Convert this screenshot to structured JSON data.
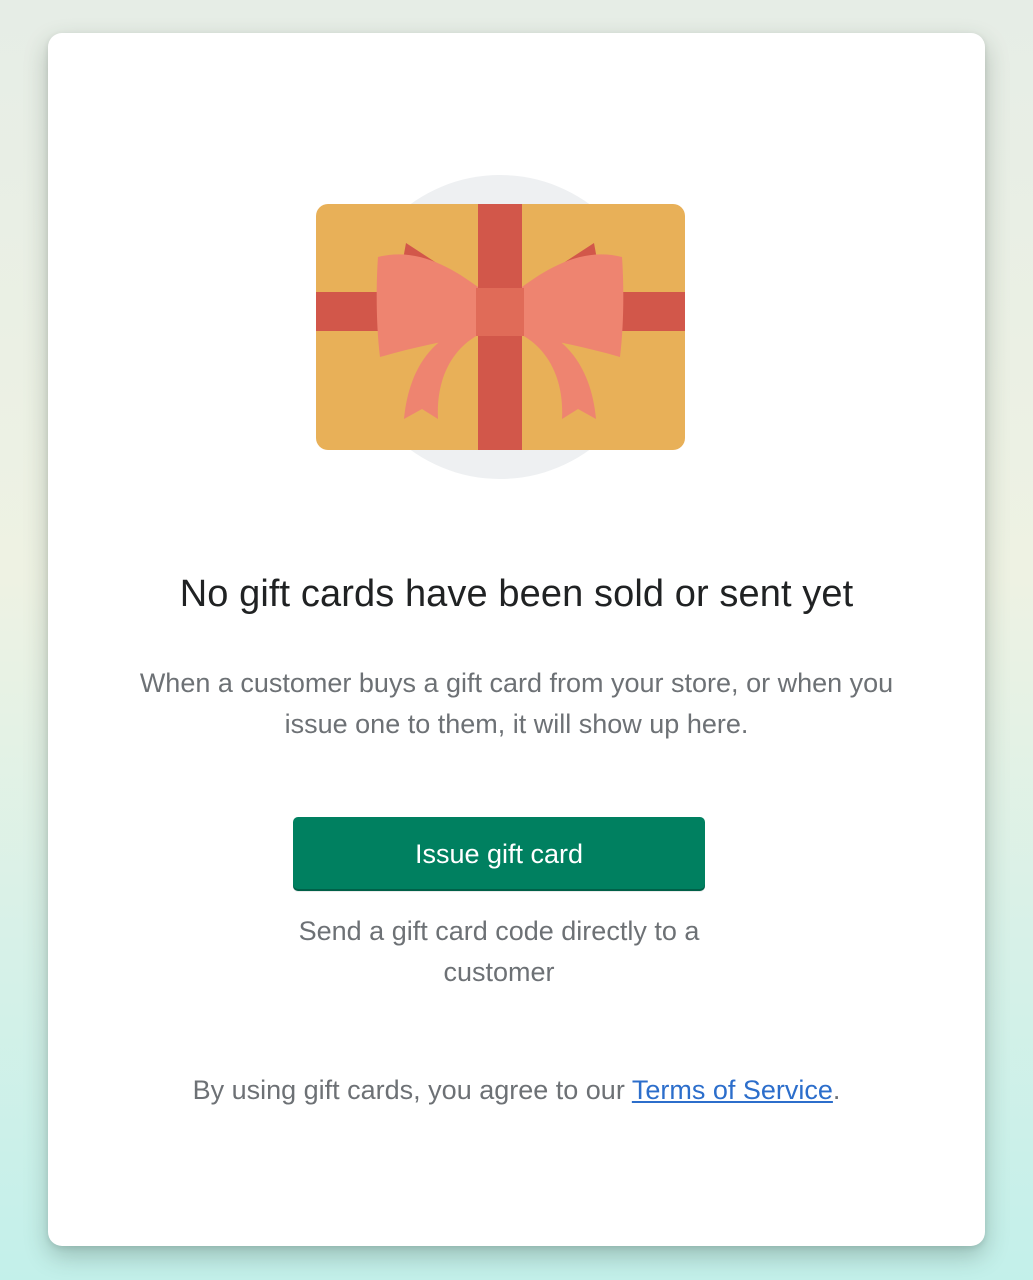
{
  "empty_state": {
    "illustration_icon": "gift-card-icon",
    "heading": "No gift cards have been sold or sent yet",
    "description": "When a customer buys a gift card from your store, or when you issue one to them, it will show up here.",
    "primary_action_label": "Issue gift card",
    "primary_action_help": "Send a gift card code directly to a customer",
    "footer_prefix": "By using gift cards, you agree to our ",
    "footer_link_label": "Terms of Service",
    "footer_suffix": "."
  },
  "colors": {
    "primary_button": "#008060",
    "link": "#2c6ecb",
    "heading_text": "#202223",
    "subdued_text": "#6d7175",
    "card_gold": "#e8b058",
    "ribbon_red": "#d2574a",
    "bow_salmon": "#ee8470"
  }
}
